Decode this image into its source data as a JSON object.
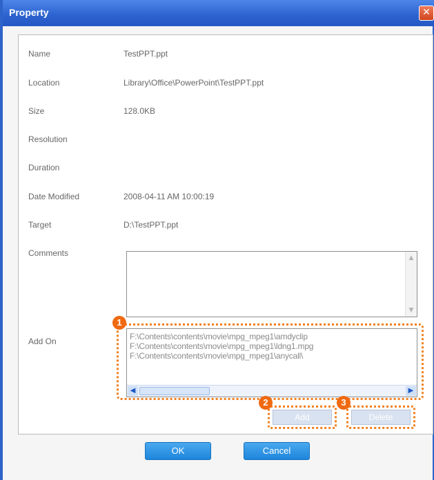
{
  "window": {
    "title": "Property",
    "close_glyph": "✕"
  },
  "properties": [
    {
      "label": "Name",
      "value": "TestPPT.ppt"
    },
    {
      "label": "Location",
      "value": "Library\\Office\\PowerPoint\\TestPPT.ppt"
    },
    {
      "label": "Size",
      "value": "128.0KB"
    },
    {
      "label": "Resolution",
      "value": ""
    },
    {
      "label": "Duration",
      "value": ""
    },
    {
      "label": "Date Modified",
      "value": "2008-04-11 AM 10:00:19"
    },
    {
      "label": "Target",
      "value": "D:\\TestPPT.ppt"
    }
  ],
  "comments": {
    "label": "Comments",
    "value": ""
  },
  "addon": {
    "label": "Add On",
    "items": [
      "F:\\Contents\\contents\\movie\\mpg_mpeg1\\amdyclip",
      "F:\\Contents\\contents\\movie\\mpg_mpeg1\\ldng1.mpg",
      "F:\\Contents\\contents\\movie\\mpg_mpeg1\\anycall\\"
    ]
  },
  "buttons": {
    "add": "Add",
    "delete": "Delete",
    "ok": "OK",
    "cancel": "Cancel"
  },
  "badges": [
    "1",
    "2",
    "3"
  ],
  "colors": {
    "title_bar": "#2c62cf",
    "highlight": "#f08020",
    "primary_button": "#1d86dc"
  }
}
